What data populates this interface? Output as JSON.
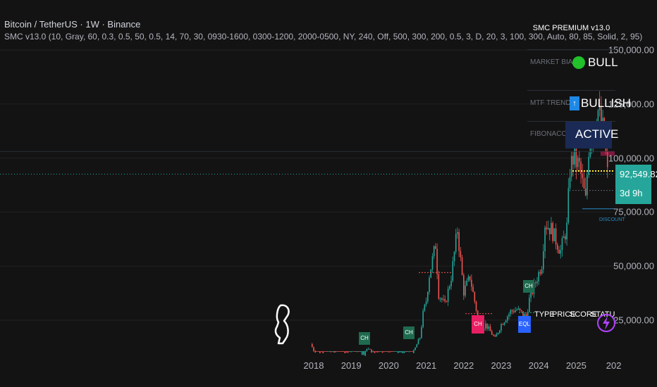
{
  "header": {
    "symbol": "Bitcoin / TetherUS · 1W · Binance",
    "indicator": "SMC v13.0 (10, Gray, 60, 0.3, 0.5, 50, 0.5, 14, 70, 30, 0930-1600, 0300-1200, 2000-0500, NY, 240, Off, 500, 300, 200, 0.5, 3, D, 20, 3, 100, 300, Auto, 80, 85, Solid, 2, 95)"
  },
  "panel": {
    "title": "SMC PREMIUM v13.0",
    "rows": [
      {
        "key": "MARKET BIAS",
        "value": "BULL"
      },
      {
        "key": "MTF TREND",
        "value": "BULLISH",
        "icon": "↑"
      },
      {
        "key": "FIBONACCI",
        "value": "ACTIVE"
      }
    ]
  },
  "price_tag": {
    "price": "92,549.82",
    "countdown": "3d 9h"
  },
  "table_header": {
    "type": "TYPE",
    "price": "PRICE",
    "score": "SCORE",
    "status": "STATU"
  },
  "labels": {
    "ch": "CH",
    "eql": "EQL",
    "discount": "DISCOUNT"
  },
  "colors": {
    "bull": "#26a69a",
    "bear": "#ef5350",
    "ch_box": "#1f6b4f",
    "ch_bear": "#e91e63",
    "eql_box": "#2962ff",
    "bias_dot": "#22c02a",
    "lightning": "#b042ff"
  },
  "chart_data": {
    "type": "candlestick",
    "title": "Bitcoin / TetherUS · 1W · Binance",
    "yticks": [
      25000,
      50000,
      75000,
      100000,
      125000,
      150000
    ],
    "ytick_labels": [
      "25,000.00",
      "50,000.00",
      "75,000.00",
      "100,000.00",
      "125,000.00",
      "150,000.00"
    ],
    "xticks": [
      "2018",
      "2019",
      "2020",
      "2021",
      "2022",
      "2023",
      "2024",
      "2025",
      "202"
    ],
    "ylim": [
      10000,
      155000
    ],
    "current_price": 92549.82,
    "series": [
      {
        "x": "2017-12",
        "y": 14000
      },
      {
        "x": "2018-01",
        "y": 11000
      },
      {
        "x": "2018-04",
        "y": 8000
      },
      {
        "x": "2018-07",
        "y": 7000
      },
      {
        "x": "2018-10",
        "y": 6500
      },
      {
        "x": "2018-12",
        "y": 3800
      },
      {
        "x": "2019-04",
        "y": 5000
      },
      {
        "x": "2019-06",
        "y": 12000
      },
      {
        "x": "2019-09",
        "y": 9000
      },
      {
        "x": "2019-12",
        "y": 7200
      },
      {
        "x": "2020-03",
        "y": 5500
      },
      {
        "x": "2020-06",
        "y": 9300
      },
      {
        "x": "2020-09",
        "y": 10500
      },
      {
        "x": "2020-11",
        "y": 17000
      },
      {
        "x": "2020-12",
        "y": 28000
      },
      {
        "x": "2021-01",
        "y": 34000
      },
      {
        "x": "2021-02",
        "y": 46000
      },
      {
        "x": "2021-04",
        "y": 60000
      },
      {
        "x": "2021-05",
        "y": 37000
      },
      {
        "x": "2021-07",
        "y": 32000
      },
      {
        "x": "2021-09",
        "y": 45000
      },
      {
        "x": "2021-11",
        "y": 67000
      },
      {
        "x": "2022-01",
        "y": 38000
      },
      {
        "x": "2022-03",
        "y": 45000
      },
      {
        "x": "2022-05",
        "y": 30000
      },
      {
        "x": "2022-06",
        "y": 20000
      },
      {
        "x": "2022-08",
        "y": 23000
      },
      {
        "x": "2022-11",
        "y": 16500
      },
      {
        "x": "2023-01",
        "y": 23000
      },
      {
        "x": "2023-04",
        "y": 29000
      },
      {
        "x": "2023-06",
        "y": 30000
      },
      {
        "x": "2023-09",
        "y": 26500
      },
      {
        "x": "2023-10",
        "y": 34500
      },
      {
        "x": "2023-12",
        "y": 42500
      },
      {
        "x": "2024-02",
        "y": 51000
      },
      {
        "x": "2024-03",
        "y": 70000
      },
      {
        "x": "2024-05",
        "y": 67000
      },
      {
        "x": "2024-08",
        "y": 57000
      },
      {
        "x": "2024-10",
        "y": 68000
      },
      {
        "x": "2024-11",
        "y": 95000
      },
      {
        "x": "2024-12",
        "y": 100000
      },
      {
        "x": "2025-02",
        "y": 96000
      },
      {
        "x": "2025-04",
        "y": 80000
      },
      {
        "x": "2025-05",
        "y": 105000
      },
      {
        "x": "2025-07",
        "y": 118000
      },
      {
        "x": "2025-08",
        "y": 122000
      },
      {
        "x": "2025-10",
        "y": 110000
      },
      {
        "x": "2025-11",
        "y": 92549.82
      }
    ]
  }
}
